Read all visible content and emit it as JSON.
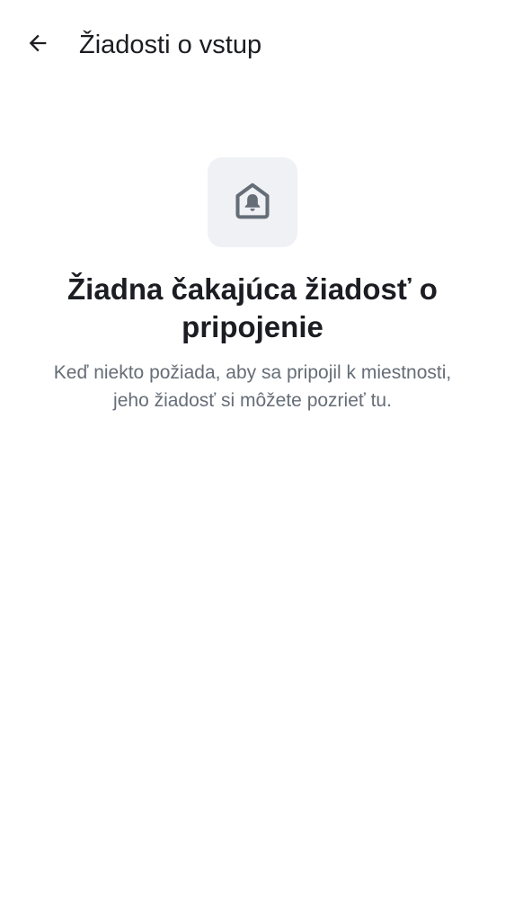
{
  "header": {
    "back_icon": "arrow-left-icon",
    "title": "Žiadosti o vstup"
  },
  "empty_state": {
    "icon": "room-notification-icon",
    "heading": "Žiadna čakajúca žiadosť o pripojenie",
    "description": "Keď niekto požiada, aby sa pripojil k miestnosti, jeho žiadosť si môžete pozrieť tu."
  },
  "colors": {
    "text_primary": "#1b1d22",
    "text_secondary": "#656d77",
    "icon": "#656d77",
    "icon_tile_background": "#eff1f5",
    "background": "#ffffff"
  }
}
